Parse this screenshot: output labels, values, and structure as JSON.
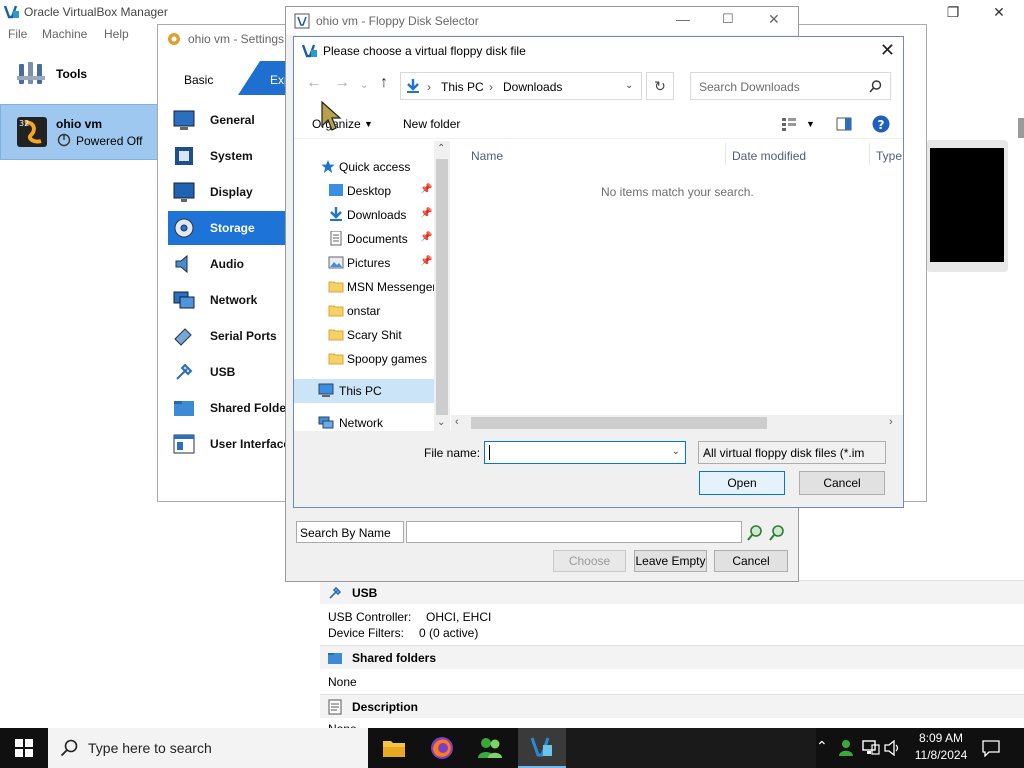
{
  "manager": {
    "title": "Oracle VirtualBox Manager",
    "menu": [
      "File",
      "Machine",
      "Help"
    ],
    "tools_label": "Tools",
    "vm_name": "ohio vm",
    "vm_state": "Powered Off",
    "usb_section": "USB",
    "usb_controller_label": "USB Controller:",
    "usb_controller_value": "OHCI, EHCI",
    "device_filters_label": "Device Filters:",
    "device_filters_value": "0 (0 active)",
    "shared_folders_section": "Shared folders",
    "shared_folders_value": "None",
    "description_section": "Description",
    "description_value": "None"
  },
  "settings": {
    "title": "ohio vm - Settings",
    "tab_basic": "Basic",
    "tab_expert": "Expert",
    "categories": [
      "General",
      "System",
      "Display",
      "Storage",
      "Audio",
      "Network",
      "Serial Ports",
      "USB",
      "Shared Folders",
      "User Interface"
    ],
    "selected_category": "Storage"
  },
  "floppy_selector": {
    "title": "ohio vm - Floppy Disk Selector",
    "search_mode": "Search By Name",
    "search_value": "",
    "choose_label": "Choose",
    "leave_empty_label": "Leave Empty",
    "cancel_label": "Cancel"
  },
  "file_dialog": {
    "title": "Please choose a virtual floppy disk file",
    "address": [
      "This PC",
      "Downloads"
    ],
    "search_placeholder": "Search Downloads",
    "organize_label": "Organize",
    "new_folder_label": "New folder",
    "nav_items": [
      {
        "label": "Quick access",
        "icon": "star-icon"
      },
      {
        "label": "Desktop",
        "icon": "desktop-icon",
        "pinned": true
      },
      {
        "label": "Downloads",
        "icon": "download-icon",
        "pinned": true
      },
      {
        "label": "Documents",
        "icon": "document-icon",
        "pinned": true
      },
      {
        "label": "Pictures",
        "icon": "pictures-icon",
        "pinned": true
      },
      {
        "label": "MSN Messenger",
        "icon": "folder-icon"
      },
      {
        "label": "onstar",
        "icon": "folder-icon"
      },
      {
        "label": "Scary Shit",
        "icon": "folder-icon"
      },
      {
        "label": "Spoopy games",
        "icon": "folder-icon"
      },
      {
        "label": "This PC",
        "icon": "computer-icon",
        "selected": true
      },
      {
        "label": "Network",
        "icon": "network-icon"
      }
    ],
    "columns": [
      "Name",
      "Date modified",
      "Type"
    ],
    "empty_message": "No items match your search.",
    "file_name_label": "File name:",
    "file_name_value": "",
    "filter_value": "All virtual floppy disk files (*.im",
    "open_label": "Open",
    "cancel_label": "Cancel"
  },
  "taskbar": {
    "search_placeholder": "Type here to search",
    "time": "8:09 AM",
    "date": "11/8/2024"
  },
  "colors": {
    "selection_blue": "#1e73d6",
    "vm_selected_bg": "#9ec8f0",
    "accent": "#0078d7"
  }
}
